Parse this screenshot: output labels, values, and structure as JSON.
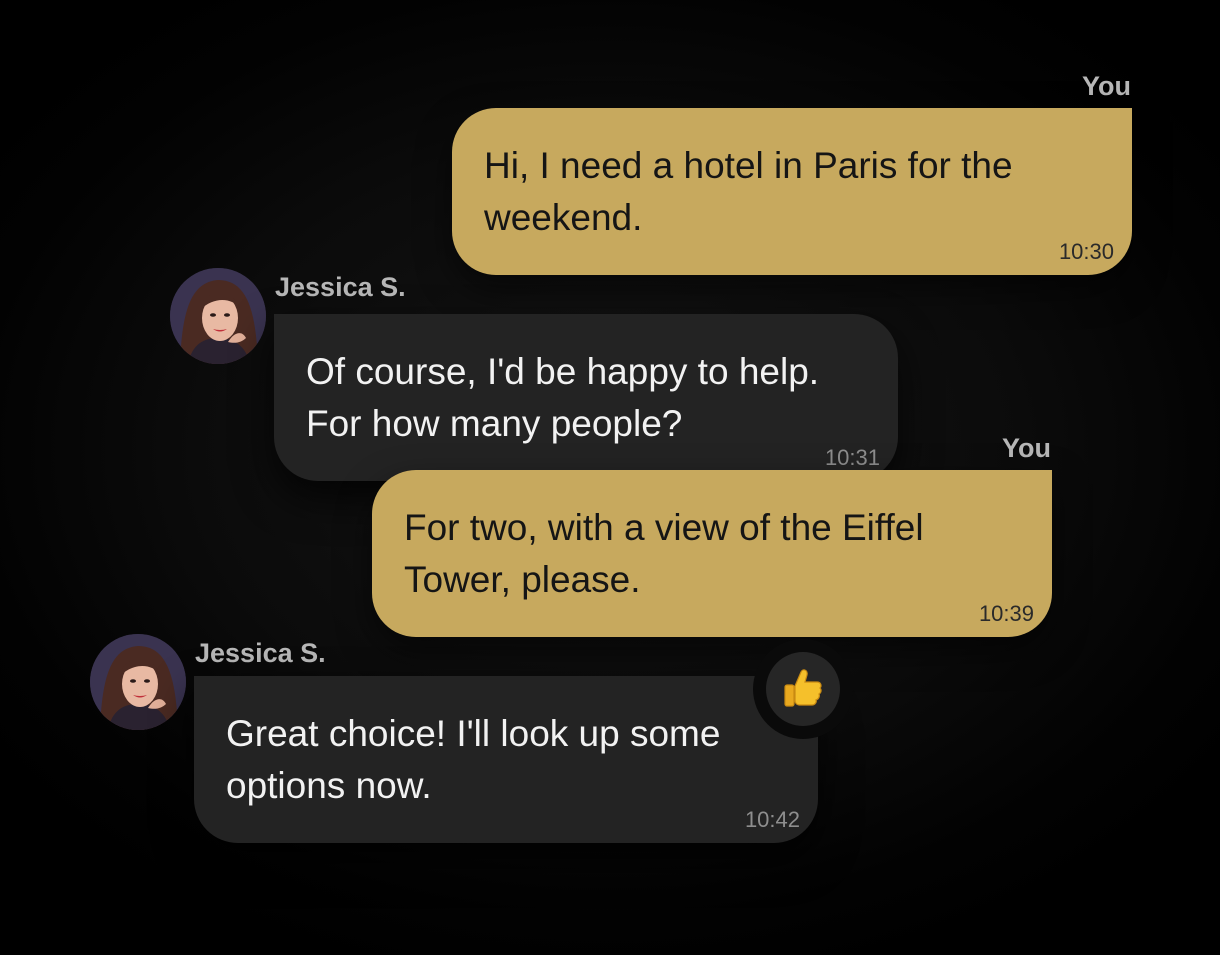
{
  "messages": [
    {
      "sender": "You",
      "direction": "outgoing",
      "text": "Hi, I need a hotel in Paris for the weekend.",
      "time": "10:30"
    },
    {
      "sender": "Jessica S.",
      "direction": "incoming",
      "text": "Of course, I'd be happy to help. For how many people?",
      "time": "10:31",
      "avatar": "avatar-woman"
    },
    {
      "sender": "You",
      "direction": "outgoing",
      "text": "For two, with a view of the Eiffel Tower, please.",
      "time": "10:39"
    },
    {
      "sender": "Jessica S.",
      "direction": "incoming",
      "text": "Great choice! I'll look up some options now.",
      "time": "10:42",
      "avatar": "avatar-woman",
      "reaction": "thumbs-up-icon"
    }
  ],
  "colors": {
    "outgoing_bubble": "#c7a95e",
    "incoming_bubble": "#232323",
    "background": "#0b0b0b",
    "sender_label": "#b7b7b7"
  }
}
